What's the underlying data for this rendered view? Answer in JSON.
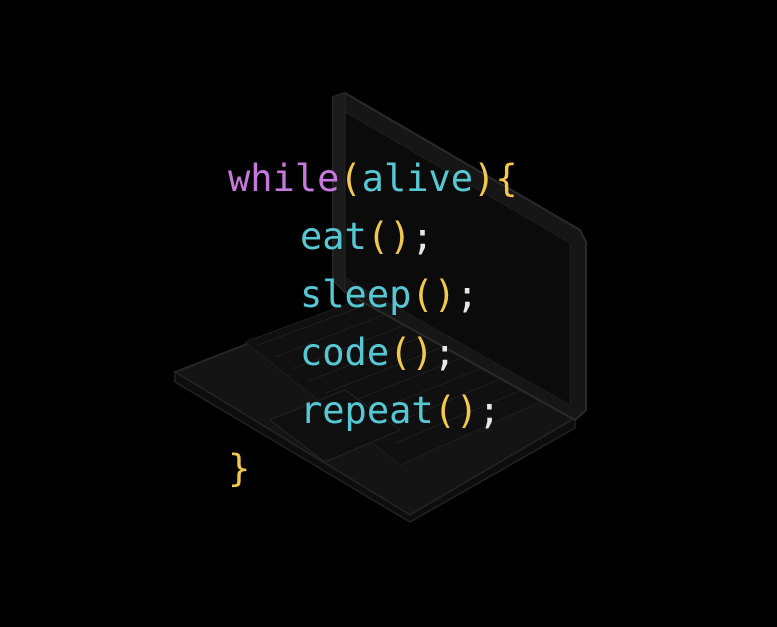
{
  "colors": {
    "background": "#000000",
    "keyword": "#c678dd",
    "identifier": "#56c8d4",
    "bracket": "#f2c94c",
    "punctuation": "#e8e8e8",
    "laptop_fill": "#121212",
    "laptop_stroke": "#2a2a2a"
  },
  "illustration": {
    "laptop_icon": "laptop-icon"
  },
  "code": {
    "line1": {
      "keyword": "while",
      "open_paren": "(",
      "arg": "alive",
      "close_paren": ")",
      "open_brace": "{"
    },
    "line2": {
      "fn": "eat",
      "parens": "()",
      "semi": ";"
    },
    "line3": {
      "fn": "sleep",
      "parens": "()",
      "semi": ";"
    },
    "line4": {
      "fn": "code",
      "parens": "()",
      "semi": ";"
    },
    "line5": {
      "fn": "repeat",
      "parens": "()",
      "semi": ";"
    },
    "line6": {
      "close_brace": "}"
    }
  }
}
